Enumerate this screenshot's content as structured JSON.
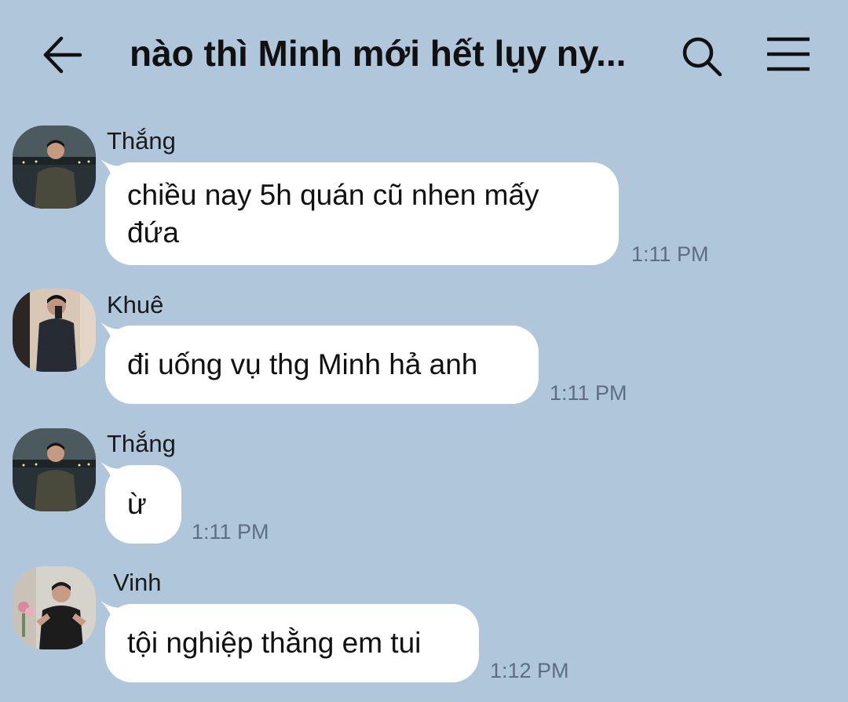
{
  "header": {
    "title": "nào thì Minh mới hết lụy ny..."
  },
  "messages": [
    {
      "sender": "Thắng",
      "text": "chiều nay 5h quán cũ nhen mấy đứa",
      "time": "1:11 PM"
    },
    {
      "sender": "Khuê",
      "text": "đi uống vụ thg Minh hả anh",
      "time": "1:11 PM"
    },
    {
      "sender": "Thắng",
      "text": "ừ",
      "time": "1:11 PM"
    },
    {
      "sender": "Vinh",
      "text": "tội nghiệp thằng em tui",
      "time": "1:12 PM"
    }
  ],
  "colors": {
    "background": "#b0c6db",
    "bubble": "#ffffff",
    "timestamp": "#5e6e80"
  },
  "icons": {
    "back": "arrow-left-icon",
    "search": "search-icon",
    "menu": "hamburger-menu-icon"
  }
}
